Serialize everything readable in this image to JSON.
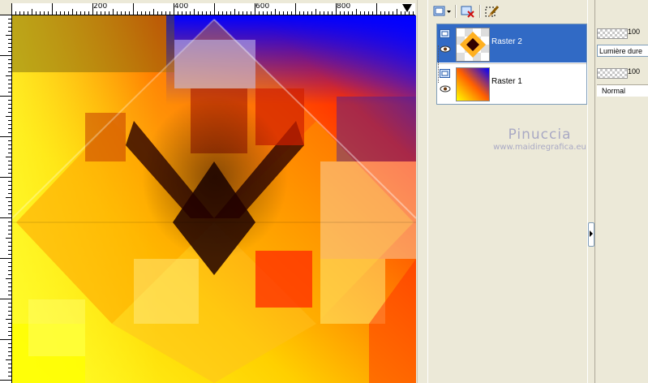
{
  "rulers": {
    "top_labels": [
      "200",
      "400",
      "600",
      "800"
    ]
  },
  "layers": {
    "items": [
      {
        "name": "Raster 2",
        "selected": true,
        "opacity": "100",
        "blend_mode": "Lumière dure"
      },
      {
        "name": "Raster 1",
        "selected": false,
        "opacity": "100",
        "blend_mode": "Normal"
      }
    ]
  },
  "watermark": {
    "title": "Pinuccia",
    "url": "www.maidiregrafica.eu"
  },
  "icons": {
    "new_layer": "new-layer-icon",
    "delete_layer": "delete-layer-icon",
    "edit_selection": "edit-selection-icon",
    "visibility": "eye-icon",
    "layer_group": "layer-type-icon"
  },
  "colors": {
    "selection": "#316ac5",
    "panel": "#ece9d8"
  }
}
